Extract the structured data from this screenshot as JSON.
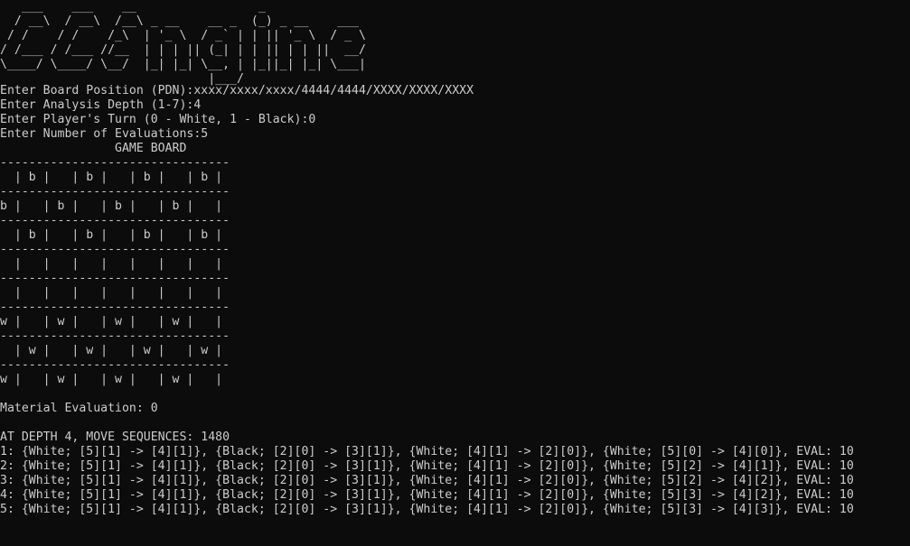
{
  "console": {
    "banner": [
      "   ___    ___    __                 _",
      "  / __\\  / __\\  /__\\ _ __    __ _  (_) _ __    ___",
      " / /    / /    /_\\  | '_ \\  / _` | | || '_ \\  / _ \\",
      "/ /___ / /___ //__  | | | || (_| | | || | | ||  __/",
      "\\____/ \\____/ \\__/  |_| |_| \\__, | |_||_| |_| \\___|",
      "                             |___/"
    ],
    "prompts": [
      "Enter Board Position (PDN):xxxx/xxxx/xxxx/4444/4444/XXXX/XXXX/XXXX",
      "Enter Analysis Depth (1-7):4",
      "Enter Player's Turn (0 - White, 1 - Black):0",
      "Enter Number of Evaluations:5"
    ],
    "board_title": "                GAME BOARD",
    "board": [
      "--------------------------------",
      "  | b |   | b |   | b |   | b |",
      "--------------------------------",
      "b |   | b |   | b |   | b |   |",
      "--------------------------------",
      "  | b |   | b |   | b |   | b |",
      "--------------------------------",
      "  |   |   |   |   |   |   |   |",
      "--------------------------------",
      "  |   |   |   |   |   |   |   |",
      "--------------------------------",
      "w |   | w |   | w |   | w |   |",
      "--------------------------------",
      "  | w |   | w |   | w |   | w |",
      "--------------------------------",
      "w |   | w |   | w |   | w |   |"
    ],
    "material_evaluation": "Material Evaluation: 0",
    "depth_summary": "AT DEPTH 4, MOVE SEQUENCES: 1480",
    "sequences": [
      "1: {White; [5][1] -> [4][1]}, {Black; [2][0] -> [3][1]}, {White; [4][1] -> [2][0]}, {White; [5][0] -> [4][0]}, EVAL: 10",
      "2: {White; [5][1] -> [4][1]}, {Black; [2][0] -> [3][1]}, {White; [4][1] -> [2][0]}, {White; [5][2] -> [4][1]}, EVAL: 10",
      "3: {White; [5][1] -> [4][1]}, {Black; [2][0] -> [3][1]}, {White; [4][1] -> [2][0]}, {White; [5][2] -> [4][2]}, EVAL: 10",
      "4: {White; [5][1] -> [4][1]}, {Black; [2][0] -> [3][1]}, {White; [4][1] -> [2][0]}, {White; [5][3] -> [4][2]}, EVAL: 10",
      "5: {White; [5][1] -> [4][1]}, {Black; [2][0] -> [3][1]}, {White; [4][1] -> [2][0]}, {White; [5][3] -> [4][3]}, EVAL: 10"
    ],
    "colors": {
      "background": "#0c0c0c",
      "foreground": "#cccccc"
    }
  }
}
